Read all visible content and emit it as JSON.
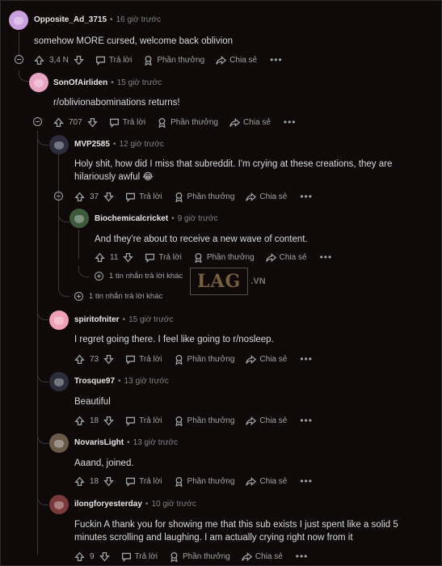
{
  "labels": {
    "reply": "Trả lời",
    "award": "Phần thưởng",
    "share": "Chia sẻ",
    "more": "•••"
  },
  "comments": [
    {
      "username": "Opposite_Ad_3715",
      "time": "16 giờ trước",
      "text": "somehow MORE cursed, welcome back oblivion",
      "votes": "3,4 N"
    },
    {
      "username": "SonOfAirliden",
      "time": "15 giờ trước",
      "text_link": "r/oblivionabominations",
      "text_rest": " returns!",
      "votes": "707"
    },
    {
      "username": "MVP2585",
      "time": "12 giờ trước",
      "text": "Holy shit, how did I miss that subreddit. I'm crying at these creations, they are hilariously awful 😂",
      "votes": "37"
    },
    {
      "username": "Biochemicalcricket",
      "time": "9 giờ trước",
      "text": "And they're about to receive a new wave of content.",
      "votes": "11"
    },
    {
      "username": "spiritofniter",
      "time": "15 giờ trước",
      "text_prefix": "I regret going there. I feel like going to ",
      "text_link": "r/nosleep",
      "text_suffix": ".",
      "votes": "73"
    },
    {
      "username": "Trosque97",
      "time": "13 giờ trước",
      "text": "Beautiful",
      "votes": "18"
    },
    {
      "username": "NovarisLight",
      "time": "13 giờ trước",
      "text": "Aaand, joined.",
      "votes": "18"
    },
    {
      "username": "ilongforyesterday",
      "time": "10 giờ trước",
      "text": "Fuckin A thank you for showing me that this sub exists I just spent like a solid 5 minutes scrolling and laughing. I am actually crying right now from it",
      "votes": "9"
    }
  ],
  "more_replies": [
    "1 tin nhắn trả lời khác",
    "1 tin nhắn trả lời khác"
  ],
  "watermark": {
    "main": "LAG",
    "suffix": ".VN"
  }
}
